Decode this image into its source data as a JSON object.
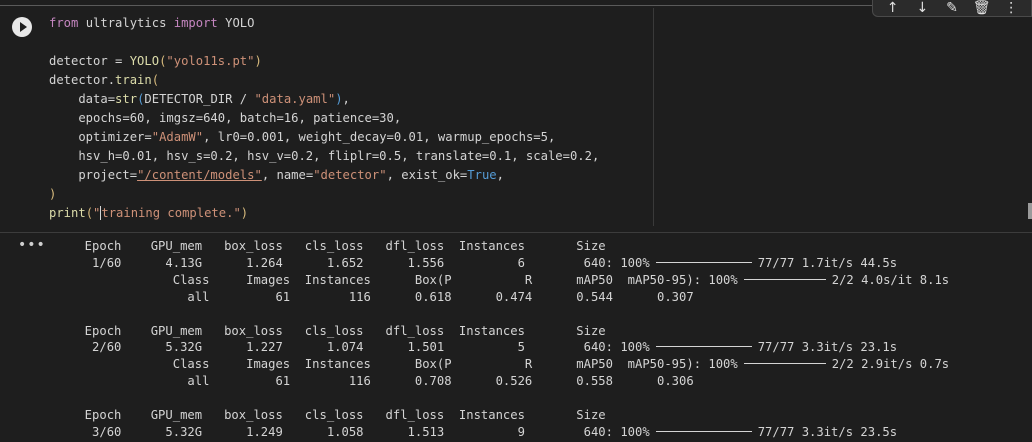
{
  "toolbar": {
    "icons": [
      "arrow-up-icon",
      "arrow-down-icon",
      "edit-icon",
      "delete-icon",
      "more-icon"
    ],
    "glyphs": [
      "↑",
      "↓",
      "✎",
      "🗑",
      "⋮"
    ]
  },
  "output_menu": "•••",
  "code": {
    "line1_kw1": "from",
    "line1_mod": " ultralytics ",
    "line1_kw2": "import",
    "line1_cls": " YOLO",
    "line3_a": "detector = ",
    "line3_fn": "YOLO",
    "line3_str": "\"yolo11s.pt\"",
    "line4_a": "detector.",
    "line4_fn": "train",
    "line5_a": "    data=",
    "line5_fn": "str",
    "line5_b": "DETECTOR_DIR / ",
    "line5_str": "\"data.yaml\"",
    "line6": "    epochs=60, imgsz=640, batch=16, patience=30,",
    "line7_a": "    optimizer=",
    "line7_str": "\"AdamW\"",
    "line7_b": ", lr0=0.001, weight_decay=0.01, warmup_epochs=5,",
    "line8": "    hsv_h=0.01, hsv_s=0.2, hsv_v=0.2, fliplr=0.5, translate=0.1, scale=0.2,",
    "line9_a": "    project=",
    "line9_str": "\"/content/models\"",
    "line9_b": ", name=",
    "line9_str2": "\"detector\"",
    "line9_c": ", exist_ok=",
    "line9_const": "True",
    "line10": ")",
    "line11_fn": "print",
    "line11_str_a": "\"",
    "line11_str_b": "training complete.\""
  },
  "output": [
    "     Epoch    GPU_mem   box_loss   cls_loss   dfl_loss  Instances       Size",
    "      1/60      4.13G      1.264      1.652      1.556          6        640: 100%",
    "                 Class     Images  Instances      Box(P          R      mAP50  mAP50-95): 100%",
    "                   all         61        116      0.618      0.474      0.544      0.307",
    "",
    "     Epoch    GPU_mem   box_loss   cls_loss   dfl_loss  Instances       Size",
    "      2/60      5.32G      1.227      1.074      1.501          5        640: 100%",
    "                 Class     Images  Instances      Box(P          R      mAP50  mAP50-95): 100%",
    "                   all         61        116      0.708      0.526      0.558      0.306",
    "",
    "     Epoch    GPU_mem   box_loss   cls_loss   dfl_loss  Instances       Size",
    "      3/60      5.32G      1.249      1.058      1.513          9        640: 100%"
  ],
  "progress_tails": {
    "e1_train": "77/77 1.7it/s 44.5s",
    "e1_val": "2/2 4.0s/it 8.1s",
    "e2_train": "77/77 3.3it/s 23.1s",
    "e2_val": "2/2 2.9it/s 0.7s",
    "e3_train": "77/77 3.3it/s 23.5s"
  }
}
